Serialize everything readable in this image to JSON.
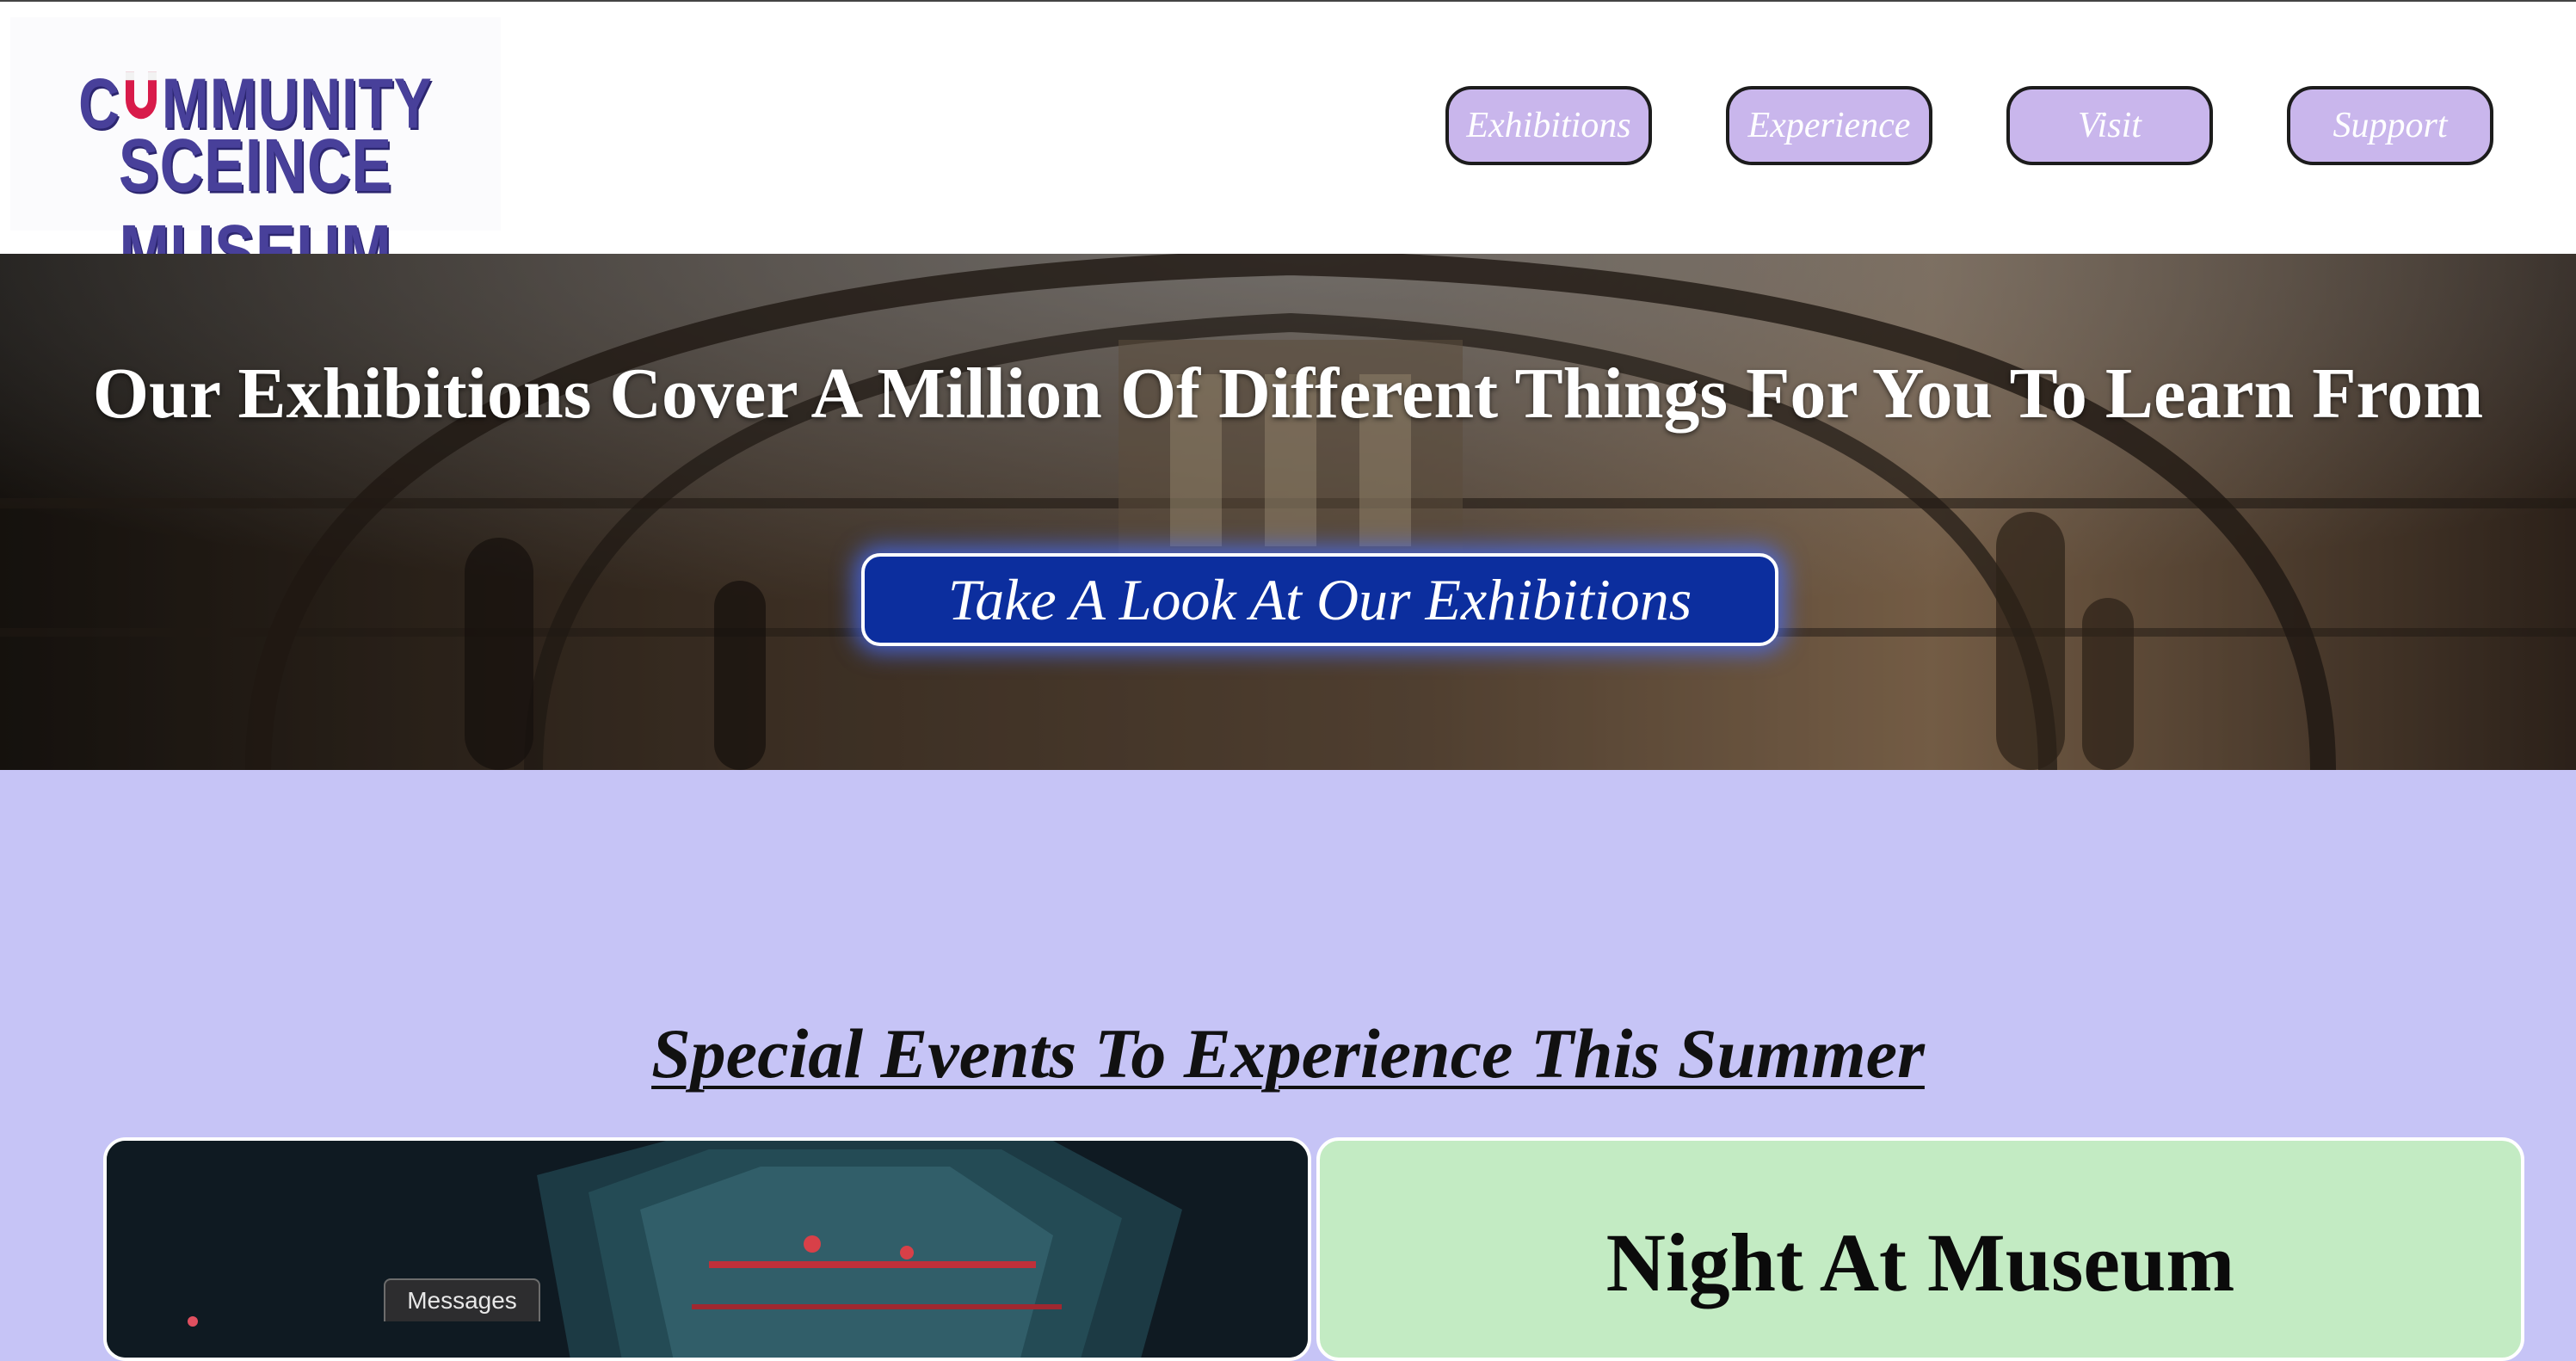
{
  "logo": {
    "line1": "COMMUNITY",
    "line1_before": "C",
    "line1_after": "MMUNITY",
    "line2": "SCEINCE MUSEUM"
  },
  "nav": [
    {
      "label": "Exhibitions"
    },
    {
      "label": "Experience"
    },
    {
      "label": "Visit"
    },
    {
      "label": "Support"
    }
  ],
  "hero": {
    "title": "Our Exhibitions Cover A Million Of Different Things For You To Learn From",
    "cta": "Take A Look At Our Exhibitions"
  },
  "events": {
    "title": "Special Events To Experience This Summer",
    "card_title": "Night At Museum"
  },
  "messages_tab": "Messages",
  "colors": {
    "nav_button": "#c9b6ec",
    "cta_button": "#0c2e9e",
    "page_background": "#c6c4f6",
    "event_card": "#c3ebc3",
    "logo_text": "#48409a",
    "magnet": "#d81b4a"
  },
  "icons": [
    "magnet-icon"
  ]
}
